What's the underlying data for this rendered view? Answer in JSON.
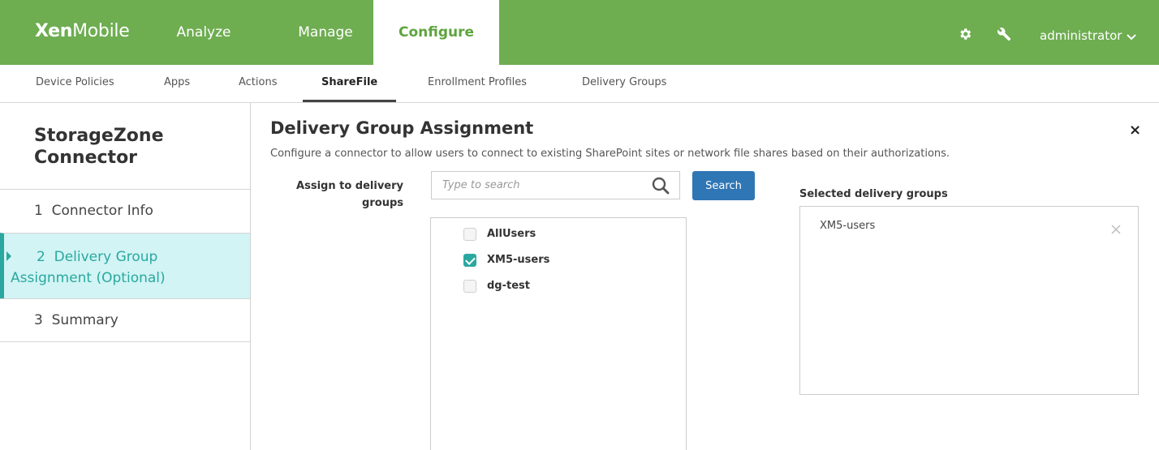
{
  "app": {
    "logo_bold": "Xen",
    "logo_light": "Mobile"
  },
  "topnav": {
    "analyze": "Analyze",
    "manage": "Manage",
    "configure": "Configure",
    "user": "administrator",
    "icons": [
      "gear-icon",
      "wrench-icon",
      "chevron-down-icon"
    ]
  },
  "subnav": {
    "items": [
      "Device Policies",
      "Apps",
      "Actions",
      "ShareFile",
      "Enrollment Profiles",
      "Delivery Groups"
    ],
    "active": "ShareFile"
  },
  "wizard": {
    "title": "StorageZone Connector",
    "steps": [
      {
        "label": "1  Connector Info"
      },
      {
        "label": "2  Delivery Group Assignment (Optional)"
      },
      {
        "label": "3  Summary"
      }
    ],
    "active_step": 2
  },
  "main": {
    "title": "Delivery Group Assignment",
    "description": "Configure a connector to allow users to connect to existing SharePoint sites or network file shares based on their authorizations.",
    "close_label": "×",
    "assign_label": "Assign to delivery groups",
    "search": {
      "placeholder": "Type to search",
      "button_label": "Search"
    },
    "groups": [
      {
        "name": "AllUsers",
        "checked": false
      },
      {
        "name": "XM5-users",
        "checked": true
      },
      {
        "name": "dg-test",
        "checked": false
      }
    ],
    "selected_label": "Selected delivery groups",
    "selected": [
      "XM5-users"
    ]
  },
  "colors": {
    "topbar": "#6ead50",
    "configure_text": "#5ea43e",
    "accent_teal": "#2aa8a0",
    "active_step_bg": "#d2f4f4",
    "search_button": "#2f76b5"
  }
}
